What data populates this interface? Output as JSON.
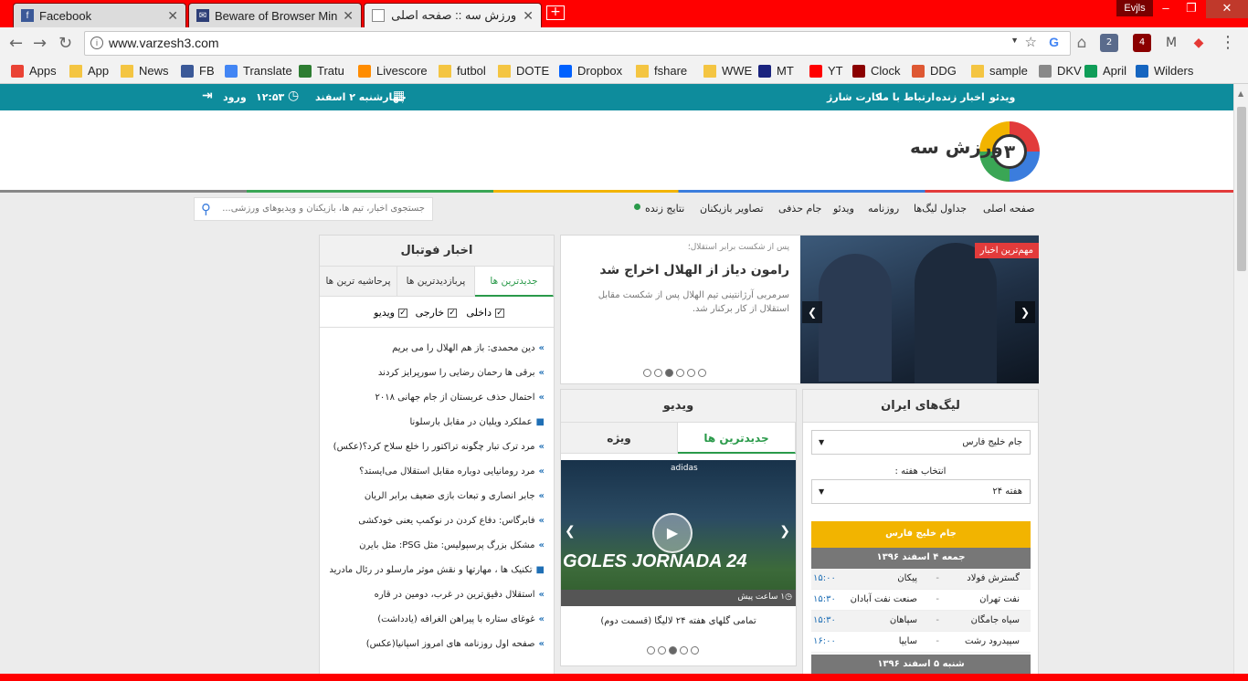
{
  "browser": {
    "tabs": [
      {
        "title": "Facebook",
        "favicon_color": "#3b5998",
        "favicon_letter": "f"
      },
      {
        "title": "Beware of Browser Minin",
        "favicon_color": "#2d3e77",
        "favicon_letter": "✉"
      },
      {
        "title": "ورزش سه :: صفحه اصلی",
        "favicon_color": "#ffffff",
        "favicon_letter": ""
      }
    ],
    "new_tab": "+",
    "user_name": "Evjls",
    "window_controls": {
      "minimize": "–",
      "maximize": "❐",
      "close": "✕"
    },
    "url": "www.varzesh3.com",
    "nav": {
      "back": "←",
      "forward": "→",
      "reload": "↻"
    },
    "extensions": [
      {
        "name": "bookmark-star",
        "glyph": "☆"
      },
      {
        "name": "google-g",
        "glyph": "G"
      },
      {
        "name": "home",
        "glyph": "⌂"
      },
      {
        "name": "badge-2",
        "glyph": "2"
      },
      {
        "name": "ublock-4",
        "glyph": "4"
      },
      {
        "name": "gmail",
        "glyph": "M"
      },
      {
        "name": "shield",
        "glyph": "◆"
      }
    ],
    "bookmarks": [
      {
        "label": "Apps",
        "icon": "apps-grid-icon",
        "color": "#ea4335"
      },
      {
        "label": "App",
        "icon": "folder-icon",
        "color": "#f4c542"
      },
      {
        "label": "News",
        "icon": "folder-icon",
        "color": "#f4c542"
      },
      {
        "label": "FB",
        "icon": "facebook-icon",
        "color": "#3b5998"
      },
      {
        "label": "Translate",
        "icon": "translate-icon",
        "color": "#4285f4"
      },
      {
        "label": "Tratu",
        "icon": "tratu-icon",
        "color": "#2e7d32"
      },
      {
        "label": "Livescore",
        "icon": "livescore-icon",
        "color": "#ff8c00"
      },
      {
        "label": "futbol",
        "icon": "folder-icon",
        "color": "#f4c542"
      },
      {
        "label": "DOTE",
        "icon": "folder-icon",
        "color": "#f4c542"
      },
      {
        "label": "Dropbox",
        "icon": "dropbox-icon",
        "color": "#0061ff"
      },
      {
        "label": "fshare",
        "icon": "folder-icon",
        "color": "#f4c542"
      },
      {
        "label": "WWE",
        "icon": "folder-icon",
        "color": "#f4c542"
      },
      {
        "label": "MT",
        "icon": "mt-icon",
        "color": "#1a237e"
      },
      {
        "label": "YT",
        "icon": "youtube-icon",
        "color": "#ff0000"
      },
      {
        "label": "Clock",
        "icon": "clock-icon",
        "color": "#8b0000"
      },
      {
        "label": "DDG",
        "icon": "duckduckgo-icon",
        "color": "#de5833"
      },
      {
        "label": "sample",
        "icon": "folder-icon",
        "color": "#f4c542"
      },
      {
        "label": "DKV",
        "icon": "page-icon",
        "color": "#888888"
      },
      {
        "label": "April",
        "icon": "sheets-icon",
        "color": "#0f9d58"
      },
      {
        "label": "Wilders",
        "icon": "wilders-icon",
        "color": "#1565c0"
      }
    ]
  },
  "site": {
    "topbar": {
      "links": [
        "ویدئو",
        "اخبار زنده",
        "ارتباط با ما",
        "کارت شارژ"
      ],
      "date": "چهارشنبه ۲ اسفند",
      "time": "۱۲:۵۳",
      "login": "ورود"
    },
    "logo_text": "ورزش سه",
    "logo_badge": "۳",
    "menu": [
      "صفحه اصلی",
      "جداول لیگ‌ها",
      "روزنامه",
      "ویدئو",
      "جام حذفی",
      "تصاویر بازیکنان",
      "نتایج زنده"
    ],
    "search_placeholder": "جستجوی اخبار، تیم ها، بازیکنان و ویدیوهای ورزشی...",
    "football_news": {
      "title": "اخبار فوتبال",
      "tabs": [
        "جدیدترین ها",
        "پربازدیدترین ها",
        "پرحاشیه ترین ها"
      ],
      "filters": [
        "داخلی",
        "خارجی",
        "ویدیو"
      ],
      "items": [
        {
          "text": "دین محمدی: باز هم الهلال را می بریم",
          "video": false
        },
        {
          "text": "برقی ها رحمان رضایی را سورپرایز کردند",
          "video": false
        },
        {
          "text": "احتمال حذف عربستان از جام جهانی ۲۰۱۸",
          "video": false
        },
        {
          "text": "عملکرد ویلیان در مقابل بارسلونا",
          "video": true
        },
        {
          "text": "مرد ترک تبار چگونه تراکتور را خلع سلاح کرد؟(عکس)",
          "video": false
        },
        {
          "text": "مرد رومانیایی دوباره مقابل استقلال می‌ایستد؟",
          "video": false
        },
        {
          "text": "جابر انصاری و تبعات بازی ضعیف برابر الریان",
          "video": false
        },
        {
          "text": "فابرگاس: دفاع کردن در نوکمپ یعنی خودکشی",
          "video": false
        },
        {
          "text": "مشکل بزرگ پرسپولیس: مثل PSG: مثل بایرن",
          "video": false
        },
        {
          "text": "تکنیک ها ، مهارتها و نقش موثر مارسلو در رئال مادرید",
          "video": true
        },
        {
          "text": "استقلال دقیق‌ترین در غرب، دومین در قاره",
          "video": false
        },
        {
          "text": "غوغای ستاره با پیراهن الغرافه (یادداشت)",
          "video": false
        },
        {
          "text": "صفحه اول روزنامه های امروز اسپانیا(عکس)",
          "video": false
        }
      ]
    },
    "featured": {
      "badge": "مهم‌ترین اخبار",
      "kicker": "پس از شکست برابر استقلال؛",
      "headline": "رامون دیاز از الهلال اخراج شد",
      "summary_lines": [
        "سرمربی آرژانتینی تیم الهلال پس از شکست مقابل",
        "استقلال از کار برکنار شد."
      ],
      "slide_count": 6,
      "active_slide": 3,
      "prev": "❮",
      "next": "❯"
    },
    "video": {
      "title": "ویدیو",
      "tabs": [
        "ویژه",
        "جدیدترین ها"
      ],
      "thumb_text": "GOLES JORNADA 24",
      "thumb_brand": "adidas",
      "time_ago": "۱ ساعت پیش",
      "caption": "تمامی گلهای هفته ۲۴ لالیگا (قسمت دوم)",
      "slide_count": 5,
      "active_slide": 3,
      "prev": "❮",
      "next": "❯"
    },
    "leagues": {
      "title": "لیگ‌های ایران",
      "selected_league": "جام خلیج فارس",
      "week_label": "انتخاب هفته :",
      "selected_week": "هفته ۲۴",
      "league_banner": "جام خلیج فارس",
      "day1": "جمعه ۴ اسفند ۱۳۹۶",
      "matches": [
        {
          "home": "گسترش فولاد",
          "away": "پیکان",
          "time": "۱۵:۰۰"
        },
        {
          "home": "نفت تهران",
          "away": "صنعت نفت آبادان",
          "time": "۱۵:۳۰"
        },
        {
          "home": "سیاه جامگان",
          "away": "سپاهان",
          "time": "۱۵:۳۰"
        },
        {
          "home": "سپیدرود رشت",
          "away": "سایپا",
          "time": "۱۶:۰۰"
        }
      ],
      "day2": "شنبه ۵ اسفند ۱۳۹۶"
    },
    "colors": {
      "topbar": "#0e8c9c",
      "accent_red": "#e23b3b",
      "league_yellow": "#f2b400",
      "date_gray": "#777777",
      "link_blue": "#1f6fb5"
    }
  }
}
